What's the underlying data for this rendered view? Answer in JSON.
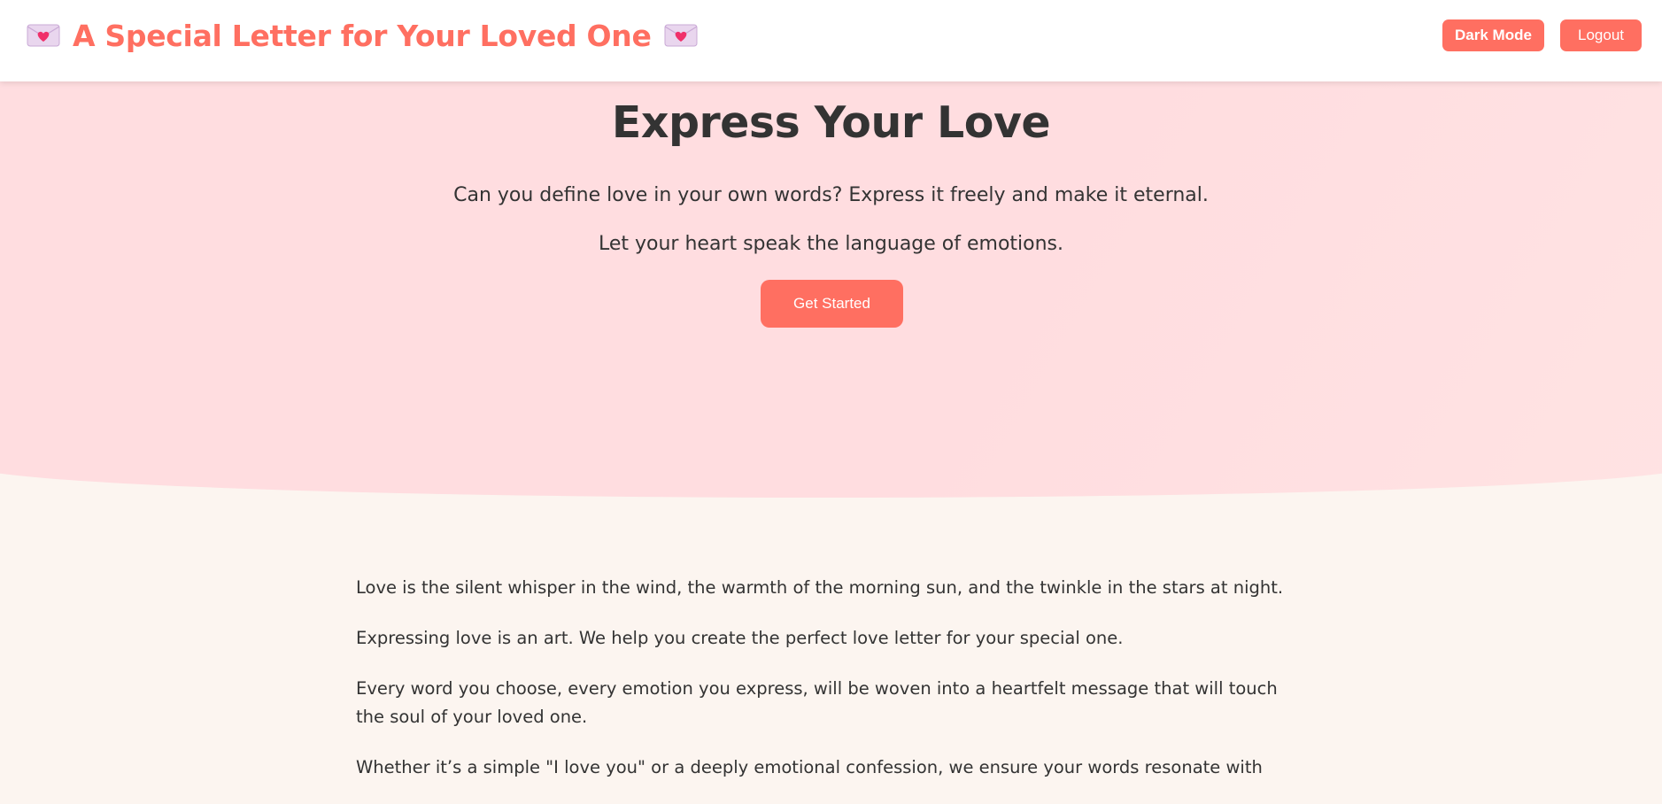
{
  "header": {
    "title": "A Special Letter for Your Loved One",
    "left_icon": "love-letter-icon",
    "right_icon": "love-letter-icon",
    "dark_mode_label": "Dark Mode",
    "logout_label": "Logout"
  },
  "hero": {
    "title": "Express Your Love",
    "line1": "Can you define love in your own words? Express it freely and make it eternal.",
    "line2": "Let your heart speak the language of emotions.",
    "cta_label": "Get Started"
  },
  "content": {
    "paragraphs": [
      "Love is the silent whisper in the wind, the warmth of the morning sun, and the twinkle in the stars at night.",
      "Expressing love is an art. We help you create the perfect love letter for your special one.",
      "Every word you choose, every emotion you express, will be woven into a heartfelt message that will touch the soul of your loved one.",
      "Whether it’s a simple \"I love you\" or a deeply emotional confession, we ensure your words resonate with"
    ]
  },
  "colors": {
    "accent": "#ff6f61",
    "hero_bg": "#ffdde0",
    "page_bg": "#fcf5f0",
    "text": "#333333"
  }
}
